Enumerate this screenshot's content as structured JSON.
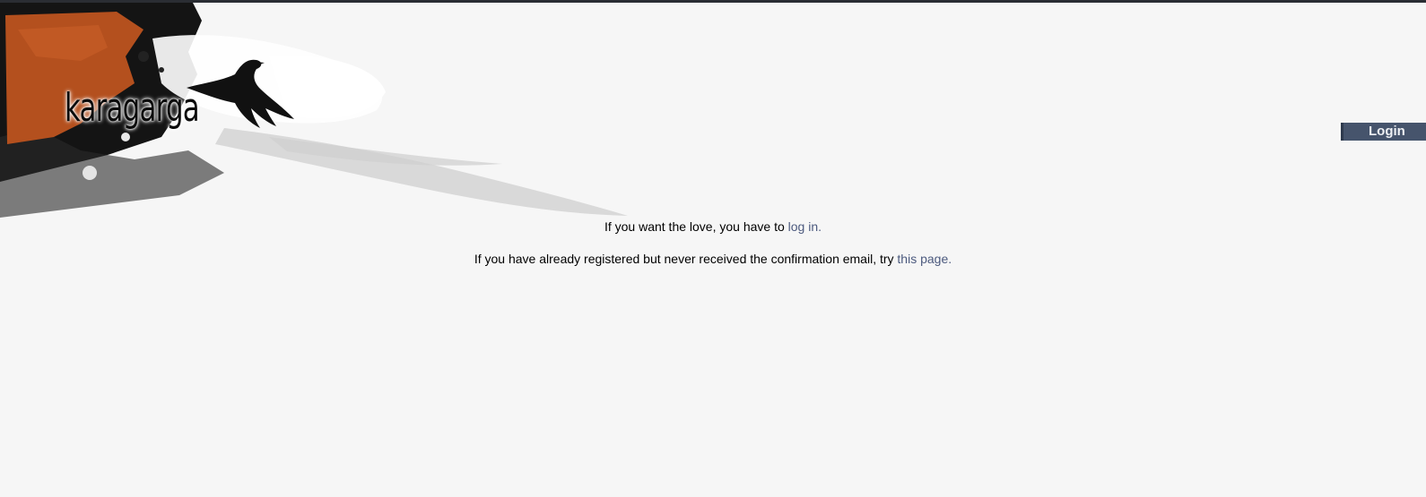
{
  "site": {
    "logo_text": "karagarga"
  },
  "header": {
    "login_label": "Login"
  },
  "main": {
    "line1": {
      "prefix": "If you want the love, you have to ",
      "link": "log in.",
      "suffix": ""
    },
    "line2": {
      "prefix": "If you have already registered but never received the confirmation email, try ",
      "link": "this page.",
      "suffix": ""
    }
  },
  "colors": {
    "background": "#f6f6f6",
    "accent_orange": "#b4501e",
    "login_button": "#46546c",
    "link": "#4c5a7e"
  },
  "icons": {
    "logo_bird": "crow-icon"
  }
}
